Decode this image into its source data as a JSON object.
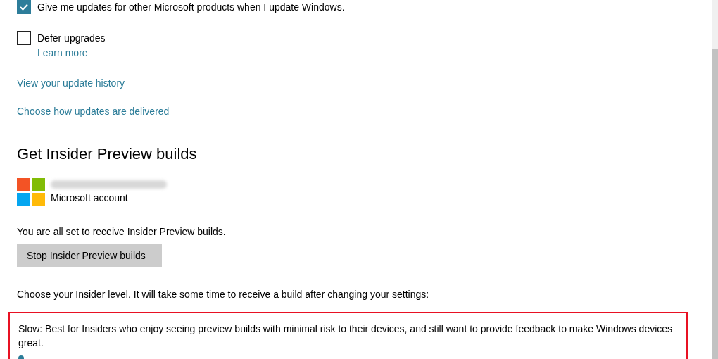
{
  "options": [
    {
      "label": "Give me updates for other Microsoft products when I update Windows.",
      "checked": true
    },
    {
      "label": "Defer upgrades",
      "checked": false,
      "link": "Learn more"
    }
  ],
  "links": [
    "View your update history",
    "Choose how updates are delivered"
  ],
  "insider": {
    "heading": "Get Insider Preview builds",
    "account_label": "Microsoft account",
    "status": "You are all set to receive Insider Preview builds.",
    "button": "Stop Insider Preview builds",
    "level_prompt": "Choose your Insider level. It will take some time to receive a build after changing your settings:",
    "level_description": "Slow: Best for Insiders who enjoy seeing preview builds with minimal risk to their devices, and still want to provide feedback to make Windows devices great."
  }
}
